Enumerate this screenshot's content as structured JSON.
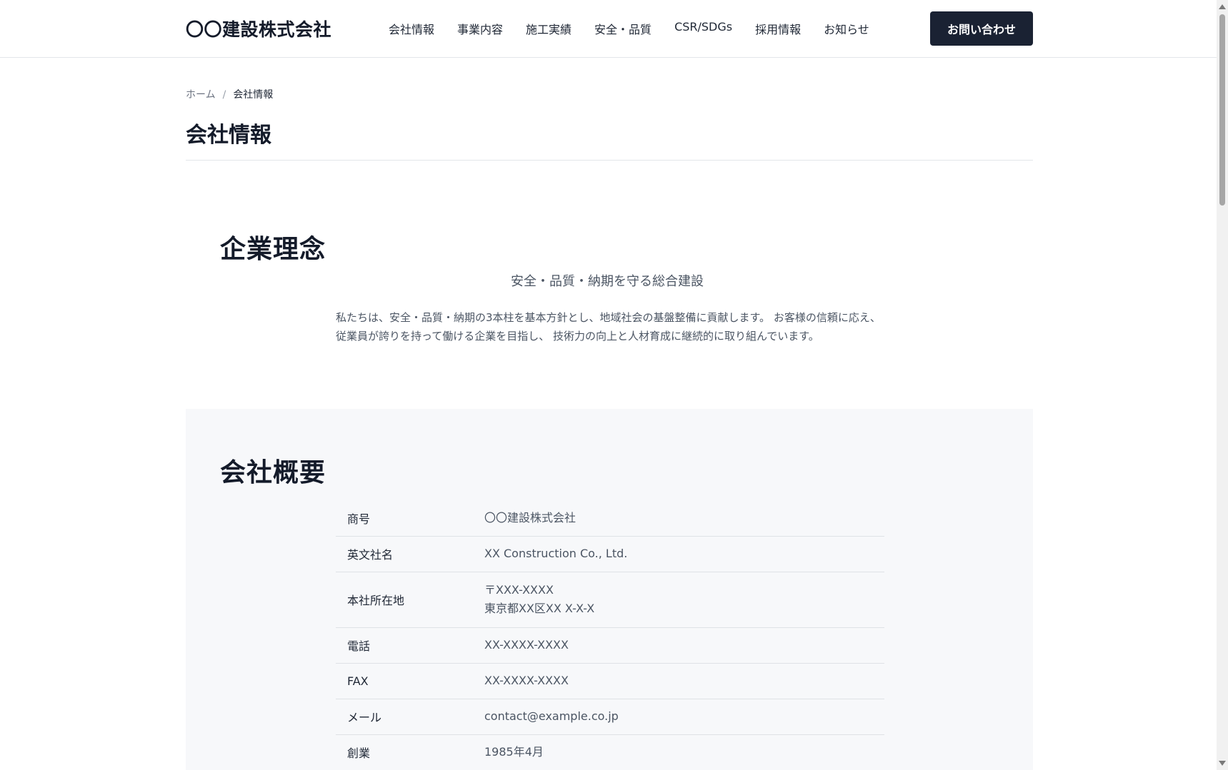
{
  "header": {
    "logo": "〇〇建設株式会社",
    "nav": [
      "会社情報",
      "事業内容",
      "施工実績",
      "安全・品質",
      "CSR/SDGs",
      "採用情報",
      "お知らせ"
    ],
    "contact_label": "お問い合わせ"
  },
  "breadcrumb": {
    "home": "ホーム",
    "separator": "/",
    "current": "会社情報"
  },
  "page_title": "会社情報",
  "philosophy": {
    "heading": "企業理念",
    "subheading": "安全・品質・納期を守る総合建設",
    "body": "私たちは、安全・品質・納期の3本柱を基本方針とし、地域社会の基盤整備に貢献します。 お客様の信頼に応え、従業員が誇りを持って働ける企業を目指し、 技術力の向上と人材育成に継続的に取り組んでいます。"
  },
  "overview": {
    "heading": "会社概要",
    "rows": [
      {
        "label": "商号",
        "lines": [
          "〇〇建設株式会社"
        ]
      },
      {
        "label": "英文社名",
        "lines": [
          "XX Construction Co., Ltd."
        ]
      },
      {
        "label": "本社所在地",
        "lines": [
          "〒XXX-XXXX",
          "東京都XX区XX X-X-X"
        ]
      },
      {
        "label": "電話",
        "lines": [
          "XX-XXXX-XXXX"
        ]
      },
      {
        "label": "FAX",
        "lines": [
          "XX-XXXX-XXXX"
        ]
      },
      {
        "label": "メール",
        "lines": [
          "contact@example.co.jp"
        ]
      },
      {
        "label": "創業",
        "lines": [
          "1985年4月"
        ]
      }
    ]
  },
  "colors": {
    "primary": "#1a2233",
    "text_muted": "#4b5563",
    "section_bg": "#f7f8fa",
    "border": "#e3e6ea"
  }
}
